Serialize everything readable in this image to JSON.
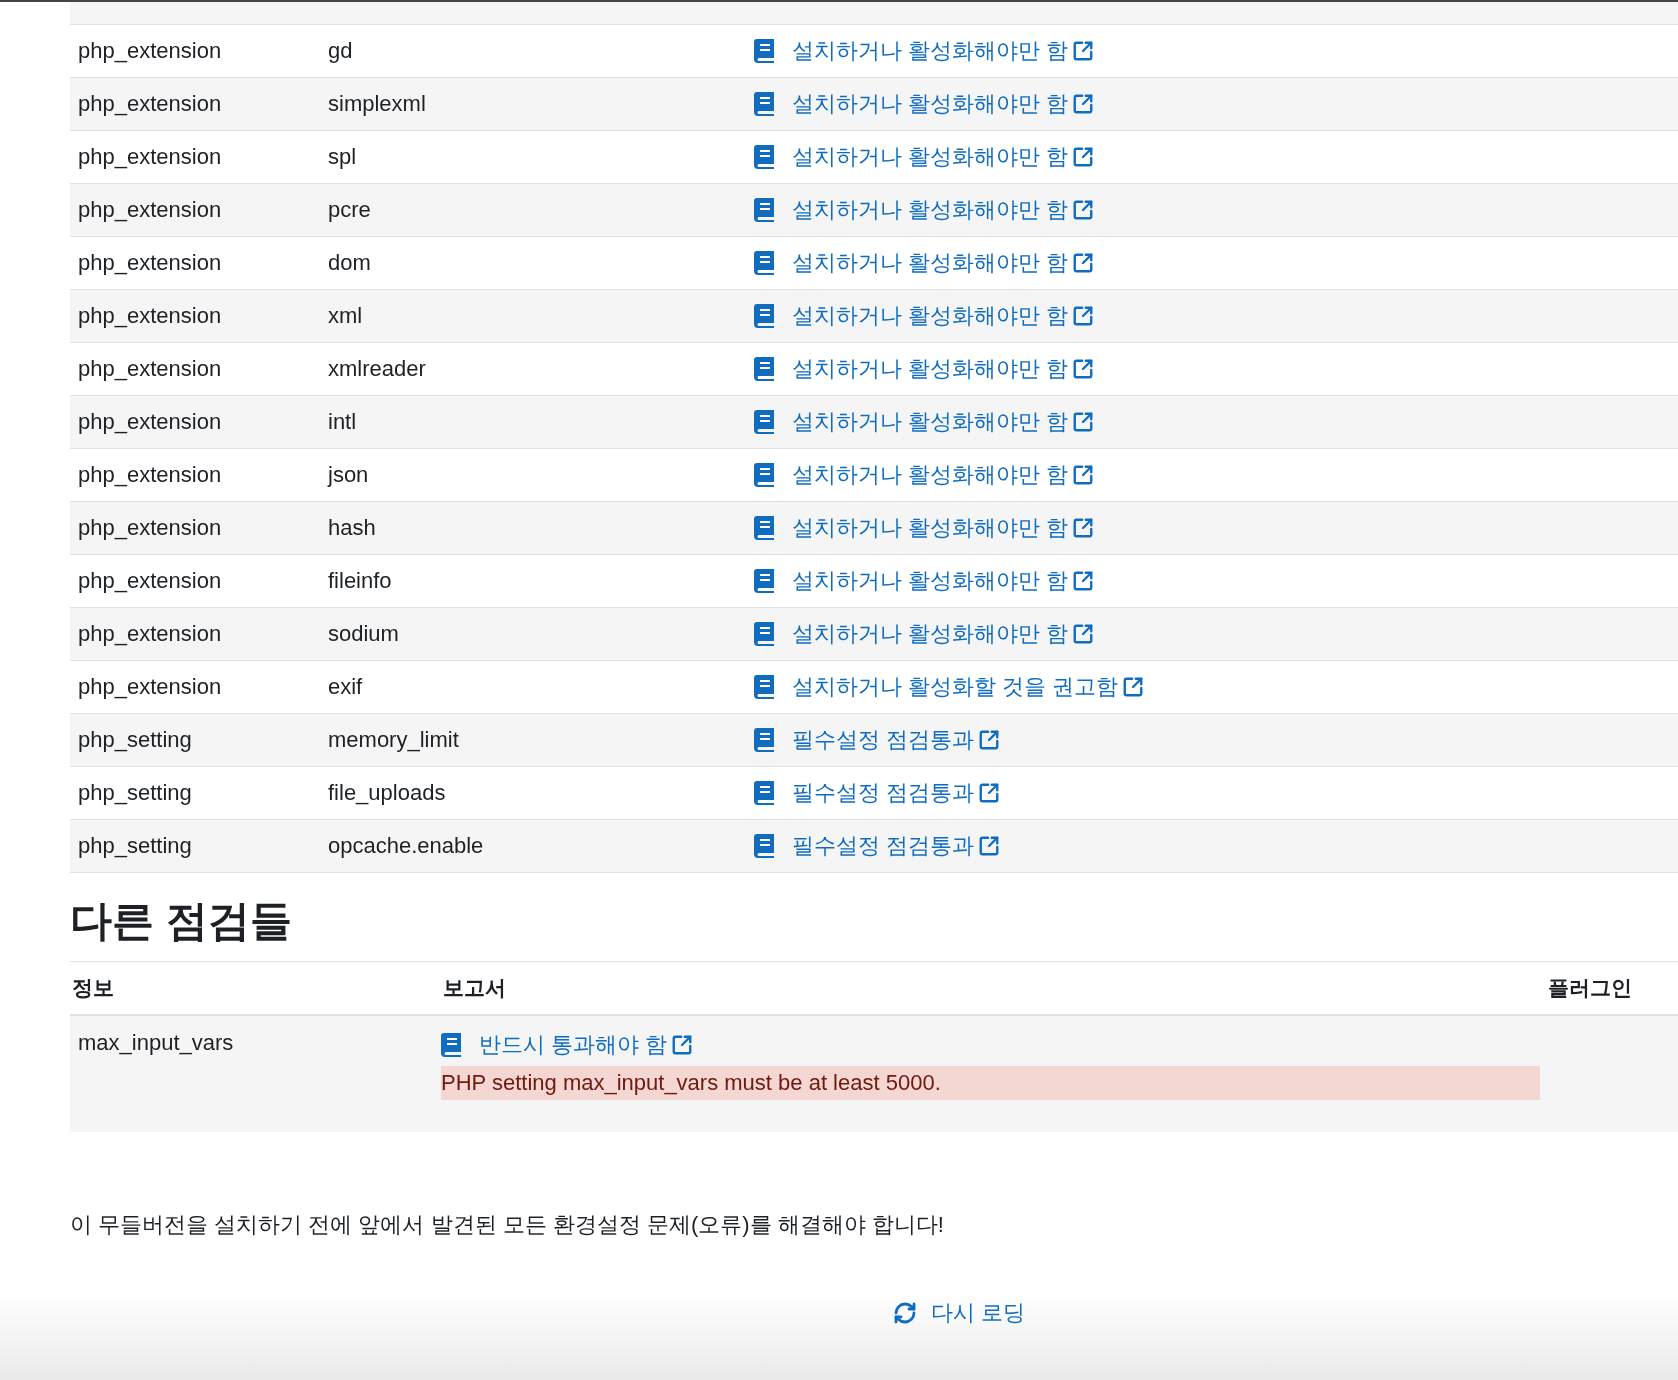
{
  "environment_table": {
    "rows": [
      {
        "type": "php_extension",
        "name": "gd",
        "report": "설치하거나 활성화해야만 함"
      },
      {
        "type": "php_extension",
        "name": "simplexml",
        "report": "설치하거나 활성화해야만 함"
      },
      {
        "type": "php_extension",
        "name": "spl",
        "report": "설치하거나 활성화해야만 함"
      },
      {
        "type": "php_extension",
        "name": "pcre",
        "report": "설치하거나 활성화해야만 함"
      },
      {
        "type": "php_extension",
        "name": "dom",
        "report": "설치하거나 활성화해야만 함"
      },
      {
        "type": "php_extension",
        "name": "xml",
        "report": "설치하거나 활성화해야만 함"
      },
      {
        "type": "php_extension",
        "name": "xmlreader",
        "report": "설치하거나 활성화해야만 함"
      },
      {
        "type": "php_extension",
        "name": "intl",
        "report": "설치하거나 활성화해야만 함"
      },
      {
        "type": "php_extension",
        "name": "json",
        "report": "설치하거나 활성화해야만 함"
      },
      {
        "type": "php_extension",
        "name": "hash",
        "report": "설치하거나 활성화해야만 함"
      },
      {
        "type": "php_extension",
        "name": "fileinfo",
        "report": "설치하거나 활성화해야만 함"
      },
      {
        "type": "php_extension",
        "name": "sodium",
        "report": "설치하거나 활성화해야만 함"
      },
      {
        "type": "php_extension",
        "name": "exif",
        "report": "설치하거나 활성화할 것을 권고함"
      },
      {
        "type": "php_setting",
        "name": "memory_limit",
        "report": "필수설정 점검통과"
      },
      {
        "type": "php_setting",
        "name": "file_uploads",
        "report": "필수설정 점검통과"
      },
      {
        "type": "php_setting",
        "name": "opcache.enable",
        "report": "필수설정 점검통과"
      }
    ]
  },
  "other_checks": {
    "title": "다른 점검들",
    "columns": [
      "정보",
      "보고서",
      "플러그인"
    ],
    "rows": [
      {
        "info": "max_input_vars",
        "report": "반드시 통과해야 함",
        "alert": {
          "kind": "error",
          "text": "PHP setting max_input_vars must be at least 5000."
        }
      }
    ]
  },
  "notice": "이 무들버전을 설치하기 전에 앞에서 발견된 모든 환경설정 문제(오류)를 해결해야 합니다!",
  "reload_button": "다시 로딩"
}
